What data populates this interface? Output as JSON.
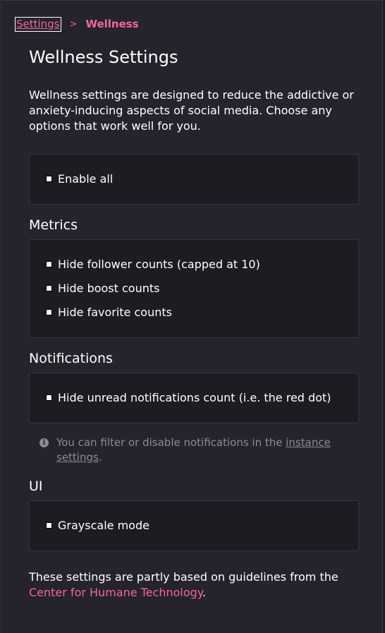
{
  "breadcrumb": {
    "parent": "Settings",
    "separator": ">",
    "current": "Wellness"
  },
  "page_title": "Wellness Settings",
  "intro": "Wellness settings are designed to reduce the addictive or anxiety-inducing aspects of social media. Choose any options that work well for you.",
  "enable_all": {
    "label": "Enable all",
    "checked": false
  },
  "metrics": {
    "heading": "Metrics",
    "options": [
      {
        "label": "Hide follower counts (capped at 10)",
        "checked": false
      },
      {
        "label": "Hide boost counts",
        "checked": false
      },
      {
        "label": "Hide favorite counts",
        "checked": false
      }
    ]
  },
  "notifications": {
    "heading": "Notifications",
    "options": [
      {
        "label": "Hide unread notifications count (i.e. the red dot)",
        "checked": false
      }
    ],
    "hint_prefix": "You can filter or disable notifications in the ",
    "hint_link": "instance settings",
    "hint_suffix": "."
  },
  "ui": {
    "heading": "UI",
    "options": [
      {
        "label": "Grayscale mode",
        "checked": false
      }
    ]
  },
  "footer": {
    "prefix": "These settings are partly based on guidelines from the ",
    "link": "Center for Humane Technology",
    "suffix": "."
  },
  "colors": {
    "accent": "#f2679f",
    "background": "#25232c",
    "box_background": "#1e1c23",
    "muted_text": "#8c8a95"
  }
}
